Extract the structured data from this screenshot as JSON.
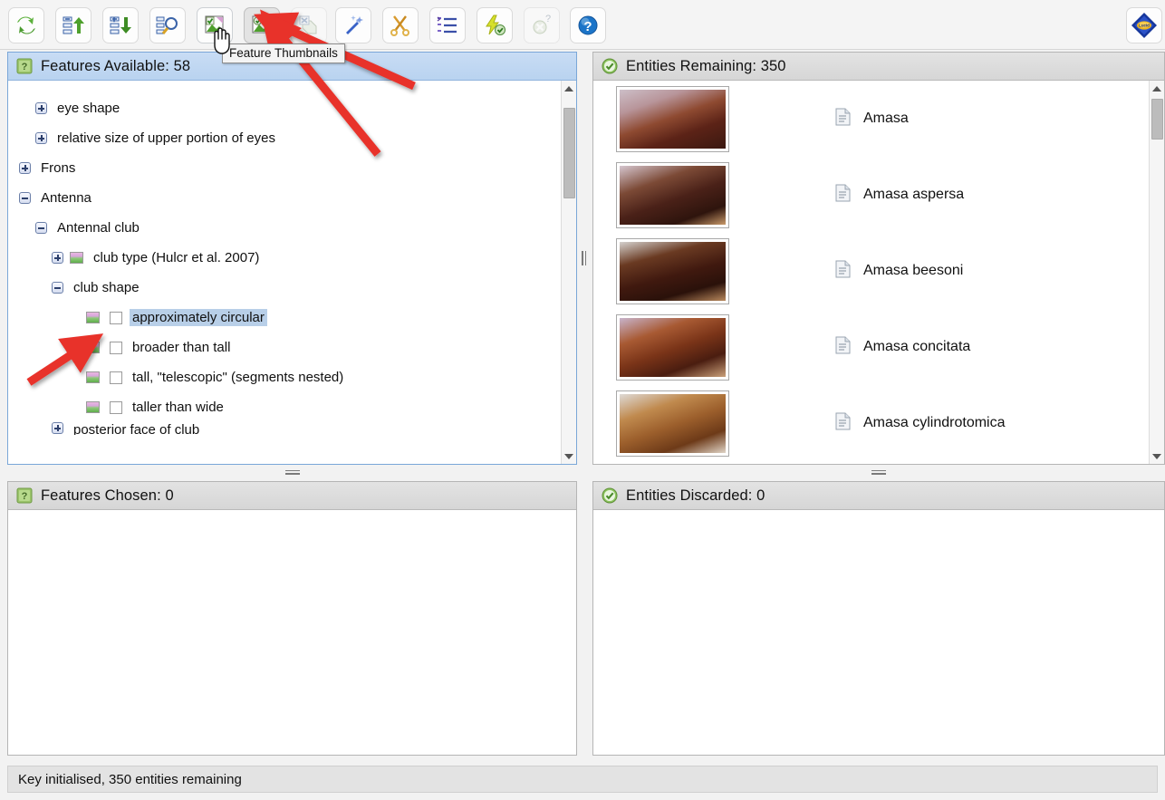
{
  "toolbar": {
    "buttons": [
      {
        "name": "refresh-restart-key-button",
        "icon": "refresh-arrows-icon",
        "state": "normal"
      },
      {
        "name": "collapse-tree-button",
        "icon": "tree-collapse-up-icon",
        "state": "normal"
      },
      {
        "name": "expand-tree-button",
        "icon": "tree-expand-down-icon",
        "state": "normal"
      },
      {
        "name": "find-feature-button",
        "icon": "tree-search-icon",
        "state": "normal"
      },
      {
        "name": "entity-thumbnails-button",
        "icon": "entity-thumbnails-icon",
        "state": "hovered"
      },
      {
        "name": "feature-thumbnails-button",
        "icon": "feature-thumbnails-icon",
        "state": "pressed"
      },
      {
        "name": "no-thumbnails-button",
        "icon": "no-thumbnails-icon",
        "state": "disabled"
      },
      {
        "name": "best-feature-button",
        "icon": "magic-wand-icon",
        "state": "normal"
      },
      {
        "name": "prune-feature-button",
        "icon": "scissors-icon",
        "state": "normal"
      },
      {
        "name": "list-features-button",
        "icon": "ordered-list-icon",
        "state": "normal"
      },
      {
        "name": "auto-advance-button",
        "icon": "lightning-check-icon",
        "state": "normal"
      },
      {
        "name": "unknown-help-button",
        "icon": "question-circle-gray-icon",
        "state": "disabled"
      },
      {
        "name": "help-button",
        "icon": "blue-question-help-icon",
        "state": "normal"
      }
    ],
    "logo": {
      "name": "app-logo",
      "icon": "blue-yellow-diamond-logo"
    },
    "tooltip": "Feature Thumbnails"
  },
  "features_available": {
    "title": "Features Available: 58",
    "icon": "green-question-icon",
    "tree": [
      {
        "indent": 0,
        "toggle": "none",
        "thumb": false,
        "check": false,
        "label": "",
        "clipped_top": true
      },
      {
        "indent": 1,
        "toggle": "plus",
        "thumb": false,
        "check": false,
        "label": "eye shape"
      },
      {
        "indent": 1,
        "toggle": "plus",
        "thumb": false,
        "check": false,
        "label": "relative size of upper portion of eyes"
      },
      {
        "indent": 0,
        "toggle": "plus",
        "thumb": false,
        "check": false,
        "label": "Frons"
      },
      {
        "indent": 0,
        "toggle": "minus",
        "thumb": false,
        "check": false,
        "label": "Antenna"
      },
      {
        "indent": 1,
        "toggle": "minus",
        "thumb": false,
        "check": false,
        "label": "Antennal club"
      },
      {
        "indent": 2,
        "toggle": "plus",
        "thumb": true,
        "check": false,
        "label": "club type (Hulcr et al. 2007)"
      },
      {
        "indent": 2,
        "toggle": "minus",
        "thumb": false,
        "check": false,
        "label": "club shape"
      },
      {
        "indent": 3,
        "toggle": "none",
        "thumb": true,
        "check": true,
        "label": "approximately circular",
        "selected": true
      },
      {
        "indent": 3,
        "toggle": "none",
        "thumb": true,
        "check": true,
        "label": "broader than tall"
      },
      {
        "indent": 3,
        "toggle": "none",
        "thumb": true,
        "check": true,
        "label": "tall, \"telescopic\" (segments nested)"
      },
      {
        "indent": 3,
        "toggle": "none",
        "thumb": true,
        "check": true,
        "label": "taller than wide"
      },
      {
        "indent": 2,
        "toggle": "plus",
        "thumb": false,
        "check": false,
        "label": "posterior face of club",
        "clipped_bottom": true
      }
    ]
  },
  "entities_remaining": {
    "title": "Entities Remaining: 350",
    "icon": "green-check-icon",
    "items": [
      {
        "name": "Amasa",
        "thumb_icon": "beetle-photo",
        "doc_icon": "document-icon"
      },
      {
        "name": "Amasa aspersa",
        "thumb_icon": "beetle-photo",
        "doc_icon": "document-icon"
      },
      {
        "name": "Amasa beesoni",
        "thumb_icon": "beetle-photo",
        "doc_icon": "document-icon"
      },
      {
        "name": "Amasa concitata",
        "thumb_icon": "beetle-photo",
        "doc_icon": "document-icon"
      },
      {
        "name": "Amasa cylindrotomica",
        "thumb_icon": "beetle-photo",
        "doc_icon": "document-icon"
      }
    ]
  },
  "features_chosen": {
    "title": "Features Chosen: 0",
    "icon": "green-question-icon",
    "items": []
  },
  "entities_discarded": {
    "title": "Entities Discarded: 0",
    "icon": "green-check-icon",
    "items": []
  },
  "statusbar": {
    "message": "Key initialised, 350 entities remaining"
  },
  "colors": {
    "focused_header": "#bdd4f0",
    "header": "#dcdcdc",
    "selection": "#b8cfe8",
    "annotation_arrow": "#e8302a"
  }
}
